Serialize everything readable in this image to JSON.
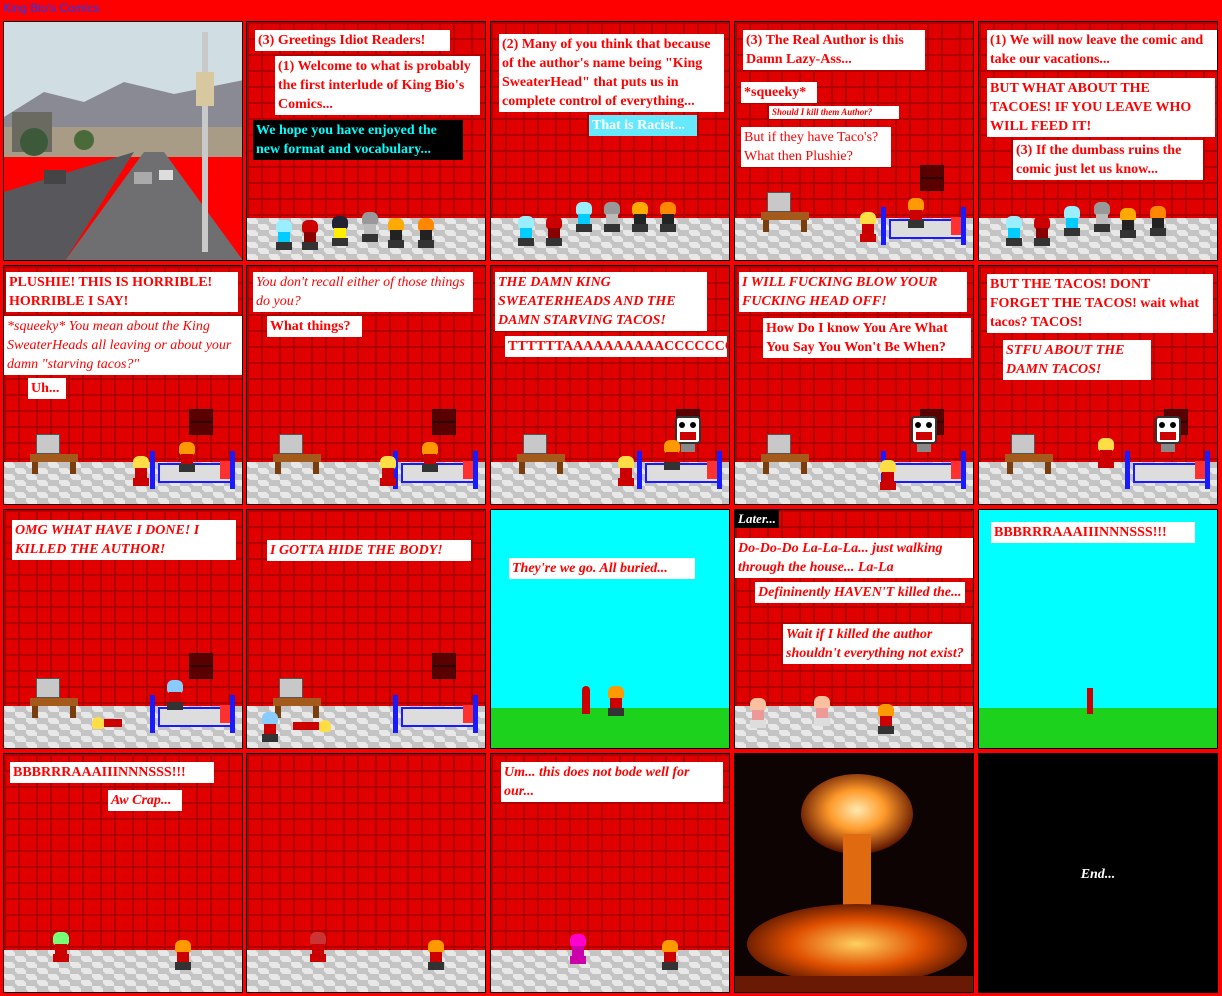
{
  "window": {
    "title": "King Bio's Comics"
  },
  "colors": {
    "background": "#ff0000",
    "bubble_text": "#ff0000",
    "sky": "#00ffff",
    "grass": "#1dd21d"
  },
  "panels": {
    "p1": {
      "scene": "photo-street"
    },
    "p2": {
      "b1": "(3) Greetings Idiot Readers!",
      "b2": "(1) Welcome to what is probably the first interlude of King Bio's Comics...",
      "b3": "We hope you have enjoyed the new format and vocabulary..."
    },
    "p3": {
      "b1": "(2) Many of you think that because of the author's name being \"King SweaterHead\" that puts us in complete control of everything...",
      "b2": "That is Racist..."
    },
    "p4": {
      "b1": "(3) The Real Author is this Damn Lazy-Ass...",
      "b2": "*squeeky*",
      "b3": "Should I kill them Author?",
      "b4": "But if they have Taco's? What then Plushie?"
    },
    "p5": {
      "b1": "(1) We will now leave the comic and take our vacations...",
      "b2": "BUT WHAT ABOUT THE TACOES! IF YOU LEAVE WHO WILL FEED IT!",
      "b3": "(3) If the dumbass ruins the comic just let us know..."
    },
    "p6": {
      "b1": "PLUSHIE! THIS IS HORRIBLE! HORRIBLE I SAY!",
      "b2": "*squeeky* You mean about the King SweaterHeads all leaving or about your damn \"starving tacos?\"",
      "b3": "Uh..."
    },
    "p7": {
      "b1": "You don't recall either of those things do you?",
      "b2": "What things?"
    },
    "p8": {
      "b1": "THE DAMN KING SWEATERHEADS AND THE DAMN STARVING TACOS!",
      "b2": "TTTTTTAAAAAAAAAACCCCCCCCCCOOOOOOOOSSSS!!!!!!!!!!"
    },
    "p9": {
      "b1": "I WILL FUCKING BLOW YOUR FUCKING HEAD OFF!",
      "b2": "How Do I know You Are What You Say You Won't Be When?"
    },
    "p10": {
      "b1": "BUT THE TACOS! DONT FORGET THE TACOS! wait what tacos? TACOS!",
      "b2": "STFU ABOUT THE DAMN TACOS!"
    },
    "p11": {
      "b1": "OMG WHAT HAVE I DONE! I KILLED THE AUTHOR!"
    },
    "p12": {
      "b1": "I GOTTA HIDE THE BODY!"
    },
    "p13": {
      "b1": "They're we go. All buried..."
    },
    "p14": {
      "later": "Later...",
      "b1": "Do-Do-Do La-La-La... just walking through the house... La-La",
      "b2": "Defininently HAVEN'T killed the...",
      "b3": "Wait if I killed the author shouldn't everything not exist?"
    },
    "p15": {
      "b1": "BBBRRRAAAIIINNNSSS!!!"
    },
    "p16": {
      "b1": "BBBRRRAAAIIINNNSSS!!!",
      "b2": "Aw Crap..."
    },
    "p17": {
      "scene": "empty-room"
    },
    "p18": {
      "b1": "Um... this does not bode well for our..."
    },
    "p19": {
      "scene": "nuclear-explosion"
    },
    "p20": {
      "end": "End..."
    }
  }
}
